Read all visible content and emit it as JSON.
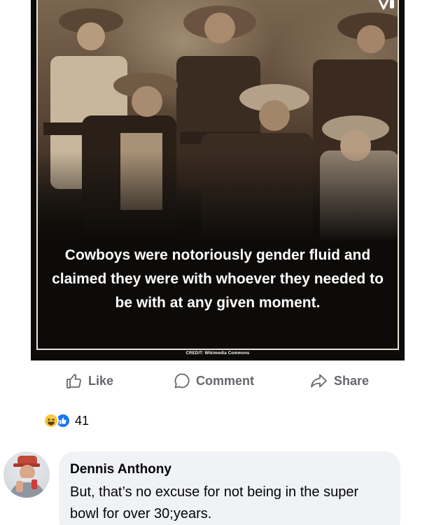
{
  "post": {
    "image_caption": "Cowboys were notoriously gender fluid and claimed they were with whoever they needed to be with at any given moment.",
    "image_credit": "CREDIT: Wikimedia Commons",
    "image_subject": "sepia group portrait of six cowboys"
  },
  "actions": {
    "like_label": "Like",
    "comment_label": "Comment",
    "share_label": "Share"
  },
  "reactions": {
    "types": [
      "haha",
      "like"
    ],
    "count": "41"
  },
  "comment": {
    "author": "Dennis Anthony",
    "text": "But, that’s no excuse for not being in the super bowl for over 30;years."
  },
  "colors": {
    "action_text": "#65676b",
    "like_blue": "#1877f2",
    "haha_yellow": "#f7c844",
    "bubble_bg": "#f0f2f5"
  }
}
